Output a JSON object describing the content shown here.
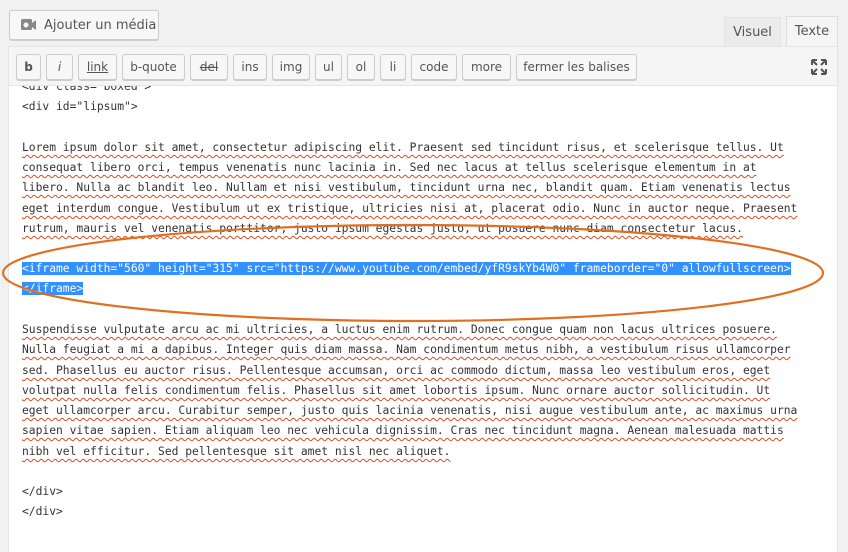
{
  "add_media": {
    "label": "Ajouter un média",
    "icon": "media-icon"
  },
  "tabs": {
    "visual": "Visuel",
    "text": "Texte"
  },
  "toolbar": {
    "buttons": [
      "b",
      "i",
      "link",
      "b-quote",
      "del",
      "ins",
      "img",
      "ul",
      "ol",
      "li",
      "code",
      "more",
      "fermer les balises"
    ],
    "fullscreen_icon": "fullscreen-icon"
  },
  "content": {
    "line0": "<div class=\"boxed\">",
    "line1": "<div id=\"lipsum\">",
    "p1": [
      "Lorem ipsum dolor sit amet, consectetur adipiscing elit. Praesent sed tincidunt risus, et scelerisque tellus. Ut",
      "consequat libero orci, tempus venenatis nunc lacinia in. Sed nec lacus at tellus scelerisque elementum in at",
      "libero. Nulla ac blandit leo. Nullam et nisi vestibulum, tincidunt urna nec, blandit quam. Etiam venenatis lectus",
      "eget interdum congue. Vestibulum ut ex tristique, ultricies nisi at, placerat odio. Nunc in auctor neque. Praesent",
      "rutrum, mauris vel venenatis porttitor, justo ipsum egestas justo, ut posuere nunc diam consectetur lacus."
    ],
    "iframe": [
      "<iframe width=\"560\" height=\"315\" src=\"https://www.youtube.com/embed/yfR9skYb4W0\" frameborder=\"0\" allowfullscreen>",
      "</iframe>"
    ],
    "p2": [
      "Suspendisse vulputate arcu ac mi ultricies, a luctus enim rutrum. Donec congue quam non lacus ultrices posuere.",
      "Nulla feugiat a mi a dapibus. Integer quis diam massa. Nam condimentum metus nibh, a vestibulum risus ullamcorper",
      "sed. Phasellus eu auctor risus. Pellentesque accumsan, orci ac commodo dictum, massa leo vestibulum eros, eget",
      "volutpat nulla felis condimentum felis. Phasellus sit amet lobortis ipsum. Nunc ornare auctor sollicitudin. Ut",
      "eget ullamcorper arcu. Curabitur semper, justo quis lacinia venenatis, nisi augue vestibulum ante, ac maximus urna",
      "sapien vitae sapien. Etiam aliquam leo nec vehicula dignissim. Cras nec tincidunt magna. Aenean malesuada mattis",
      "nibh vel efficitur. Sed pellentesque sit amet nisl nec aliquet."
    ],
    "close1": "</div>",
    "close2": "</div>"
  },
  "colors": {
    "selection": "#3390ff",
    "annotation": "#e07020",
    "spellcheck": "#d54e21"
  }
}
